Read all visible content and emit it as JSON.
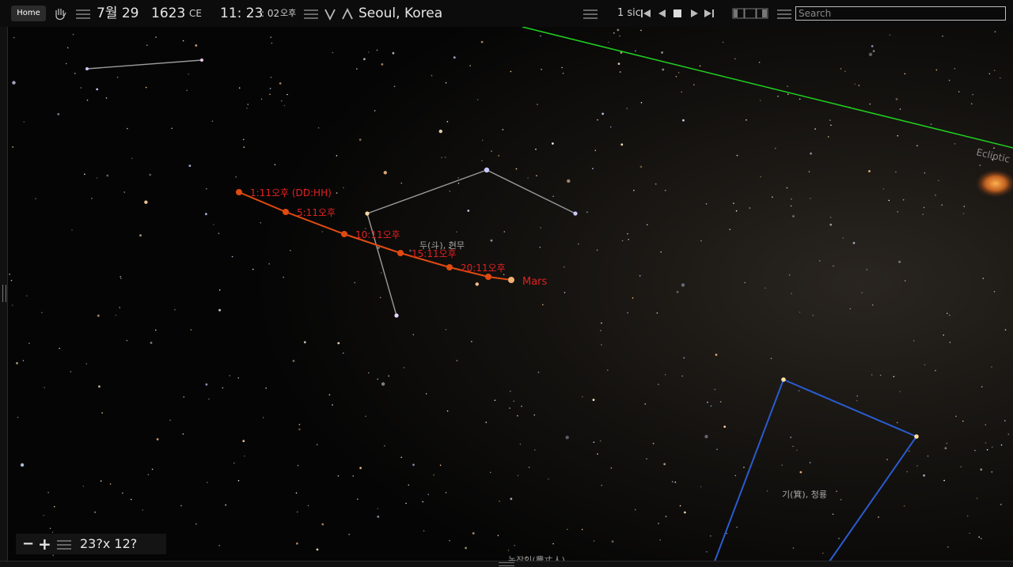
{
  "topbar": {
    "home_label": "Home",
    "month_day": "7월 29",
    "year": "1623",
    "era": "CE",
    "time_hm": "11: 23",
    "time_sec": ": 02",
    "ampm": "오후",
    "location": "Seoul, Korea",
    "speed": "1 sic",
    "search_placeholder": "Search"
  },
  "icons": {
    "hand": "hand-icon",
    "menu": "menu-icon",
    "down_arrow": "chevron-down-icon",
    "up_arrow": "chevron-up-icon",
    "skip_back": "skip-back-icon",
    "play_back": "play-reverse-icon",
    "stop": "stop-icon",
    "play": "play-icon",
    "skip_forward": "skip-forward-icon",
    "layout": "layout-icon"
  },
  "sky": {
    "ecliptic_label": "Ecliptic",
    "track_labels": [
      "1:11오후 (DD:HH)",
      "5:11오후",
      "10:11오후",
      "15:11오후",
      "20:11오후"
    ],
    "planet_label": "Mars",
    "constellation_dou": "두(斗), 현무",
    "constellation_ji": "기(箕), 청룡",
    "bottom_label": "농장인(農丈人)"
  },
  "zoom": {
    "minus": "−",
    "plus": "+",
    "fov": "23?x 12?"
  },
  "colors": {
    "track": "#e04a10",
    "track_label": "#e02020",
    "ecliptic": "#1fd21f",
    "constellation_white": "#9a9a9a",
    "constellation_blue": "#2a5bd0"
  }
}
